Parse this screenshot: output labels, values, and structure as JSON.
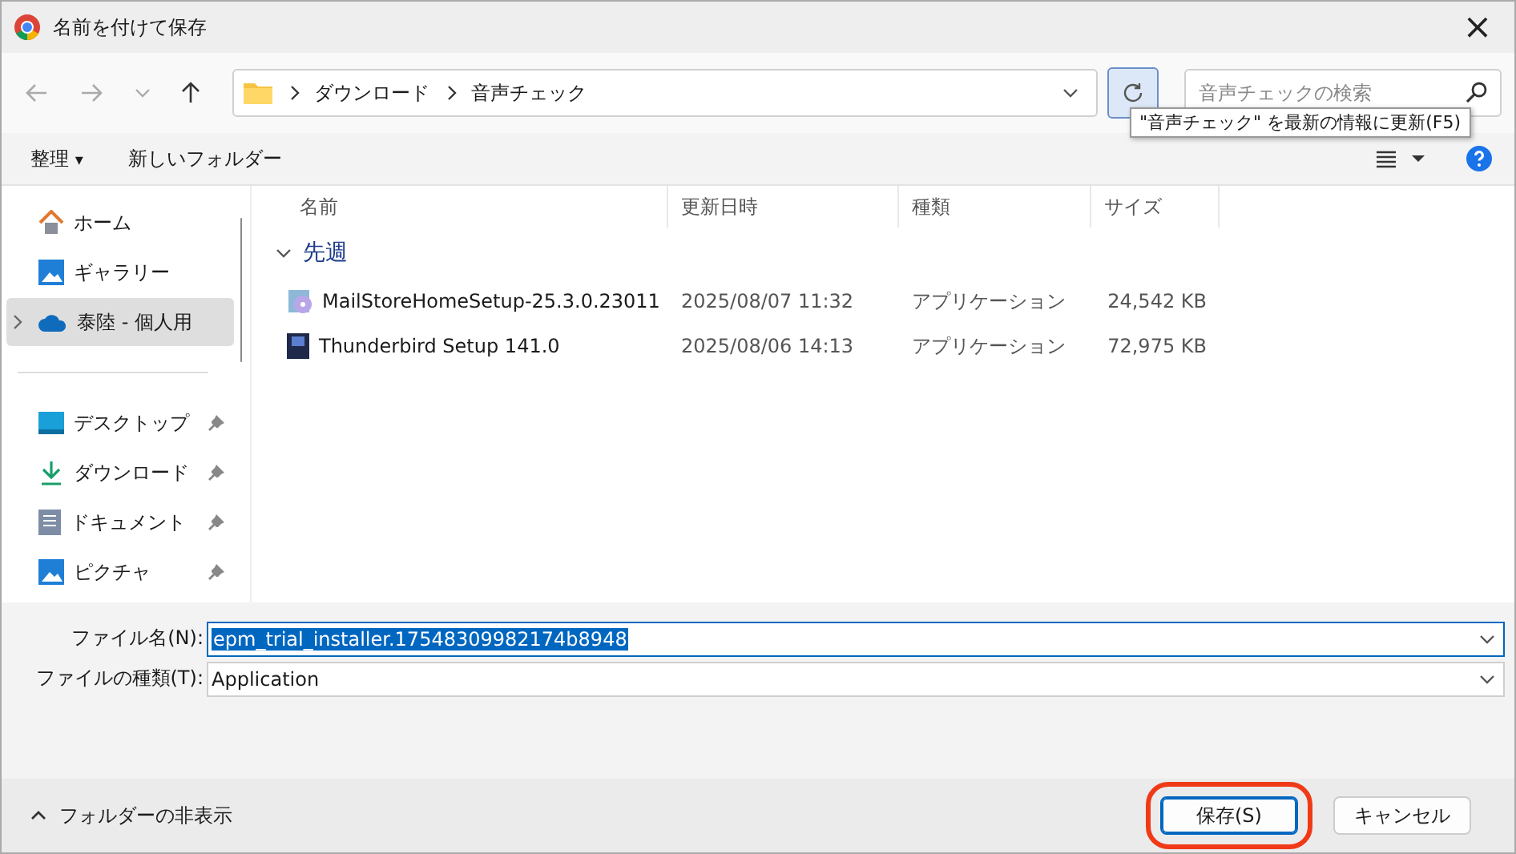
{
  "window": {
    "title": "名前を付けて保存",
    "close": "×"
  },
  "address": {
    "path": [
      {
        "label": "ダウンロード"
      },
      {
        "label": "音声チェック"
      }
    ]
  },
  "search": {
    "placeholder": "音声チェックの検索"
  },
  "tooltip": {
    "text": "\"音声チェック\" を最新の情報に更新(F5)"
  },
  "toolbar": {
    "organize": "整理",
    "organize_caret": "▾",
    "new_folder": "新しいフォルダー"
  },
  "sidebar": {
    "groups": [
      {
        "items": [
          {
            "label": "ホーム",
            "kind": "home",
            "selected": false,
            "pinned": false,
            "expandable": false
          },
          {
            "label": "ギャラリー",
            "kind": "gallery",
            "selected": false,
            "pinned": false,
            "expandable": false
          },
          {
            "label": "泰陸 - 個人用",
            "kind": "cloud",
            "selected": true,
            "pinned": false,
            "expandable": true
          }
        ]
      },
      {
        "items": [
          {
            "label": "デスクトップ",
            "kind": "desktop",
            "selected": false,
            "pinned": true,
            "expandable": false
          },
          {
            "label": "ダウンロード",
            "kind": "download",
            "selected": false,
            "pinned": true,
            "expandable": false
          },
          {
            "label": "ドキュメント",
            "kind": "document",
            "selected": false,
            "pinned": true,
            "expandable": false
          },
          {
            "label": "ピクチャ",
            "kind": "picture",
            "selected": false,
            "pinned": true,
            "expandable": false
          }
        ]
      }
    ]
  },
  "table": {
    "columns": [
      "名前",
      "更新日時",
      "種類",
      "サイズ"
    ],
    "group": {
      "label": "先週",
      "expanded": true
    },
    "rows": [
      {
        "kind": "disc",
        "name": "MailStoreHomeSetup-25.3.0.23011",
        "modified": "2025/08/07 11:32",
        "type": "アプリケーション",
        "size": "24,542 KB"
      },
      {
        "kind": "installer",
        "name": "Thunderbird Setup 141.0",
        "modified": "2025/08/06 14:13",
        "type": "アプリケーション",
        "size": "72,975 KB"
      }
    ]
  },
  "fields": [
    {
      "label": "ファイル名(N):",
      "value": "epm_trial_installer.17548309982174b8948",
      "focused": true
    },
    {
      "label": "ファイルの種類(T):",
      "value": "Application",
      "focused": false
    }
  ],
  "footer": {
    "toggle": "フォルダーの非表示",
    "buttons": [
      {
        "label": "保存(S)",
        "primary": true,
        "circled": true
      },
      {
        "label": "キャンセル",
        "primary": false,
        "circled": false
      }
    ]
  }
}
